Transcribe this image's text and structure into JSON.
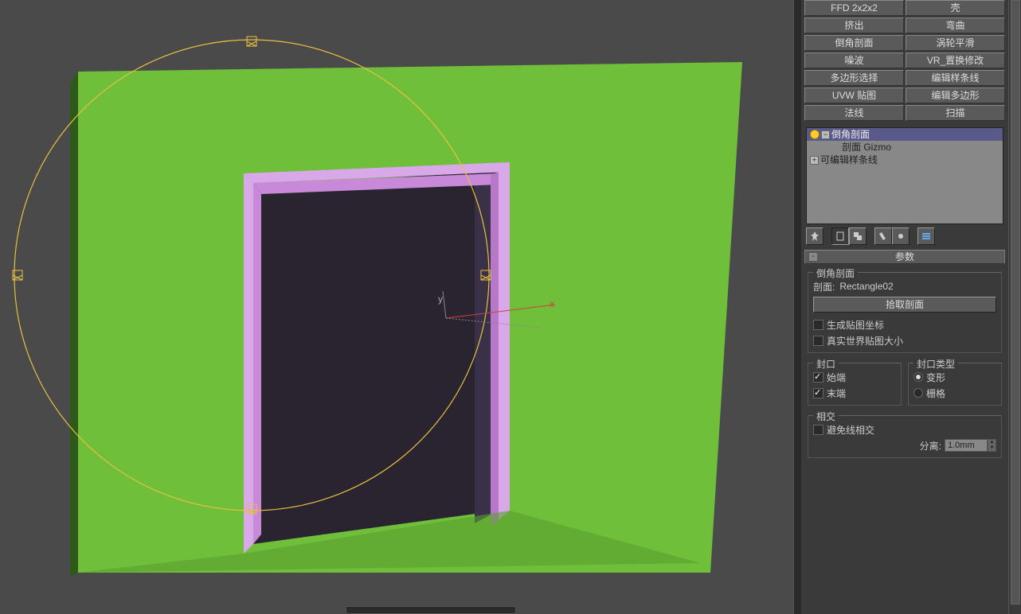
{
  "modifiers": {
    "r0c0": "FFD 2x2x2",
    "r0c1": "壳",
    "r1c0": "挤出",
    "r1c1": "弯曲",
    "r2c0": "倒角剖面",
    "r2c1": "涡轮平滑",
    "r3c0": "噪波",
    "r3c1": "VR_置换修改",
    "r4c0": "多边形选择",
    "r4c1": "编辑样条线",
    "r5c0": "UVW 贴图",
    "r5c1": "编辑多边形",
    "r6c0": "法线",
    "r6c1": "扫描"
  },
  "stack": {
    "item0": "倒角剖面",
    "item0_child": "剖面 Gizmo",
    "item1": "可编辑样条线"
  },
  "rollout_title": "参数",
  "section_profile": {
    "title": "倒角剖面",
    "label": "剖面:",
    "value": "Rectangle02",
    "pick_btn": "拾取剖面",
    "chk_gen": "生成贴图坐标",
    "chk_real": "真实世界贴图大小"
  },
  "section_cap": {
    "title": "封口",
    "chk_start": "始端",
    "chk_end": "末端"
  },
  "section_captype": {
    "title": "封口类型",
    "r_morph": "变形",
    "r_grid": "栅格"
  },
  "section_intersect": {
    "title": "相交",
    "chk_avoid": "避免线相交",
    "sep_label": "分离:",
    "sep_value": "1.0mm"
  },
  "axis": {
    "x": "x",
    "y": "y"
  }
}
